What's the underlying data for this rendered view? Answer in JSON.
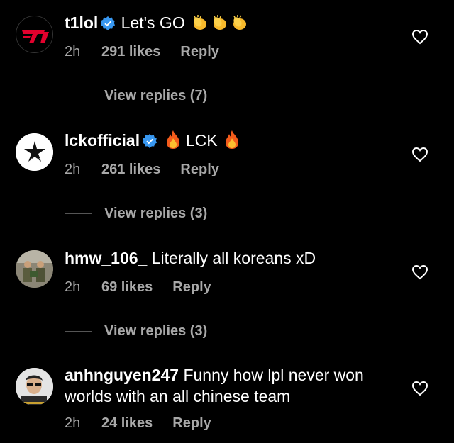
{
  "comments": [
    {
      "username": "t1lol",
      "verified": true,
      "text": "Let's GO",
      "emojis": [
        "clapping-hands",
        "clapping-hands",
        "clapping-hands"
      ],
      "time": "2h",
      "likes": "291 likes",
      "reply": "Reply",
      "view_replies": "View replies (7)"
    },
    {
      "username": "lckofficial",
      "verified": true,
      "text": "LCK",
      "time": "2h",
      "likes": "261 likes",
      "reply": "Reply",
      "view_replies": "View replies (3)"
    },
    {
      "username": "hmw_106_",
      "verified": false,
      "text": "Literally all koreans xD",
      "time": "2h",
      "likes": "69 likes",
      "reply": "Reply",
      "view_replies": "View replies (3)"
    },
    {
      "username": "anhnguyen247",
      "verified": false,
      "text": "Funny how lpl never won worlds with an all chinese team",
      "time": "2h",
      "likes": "24 likes",
      "reply": "Reply"
    }
  ],
  "colors": {
    "background": "#000000",
    "text": "#ffffff",
    "muted": "#a8a8a8",
    "verified": "#3897f0",
    "t1_red": "#e2012d"
  }
}
